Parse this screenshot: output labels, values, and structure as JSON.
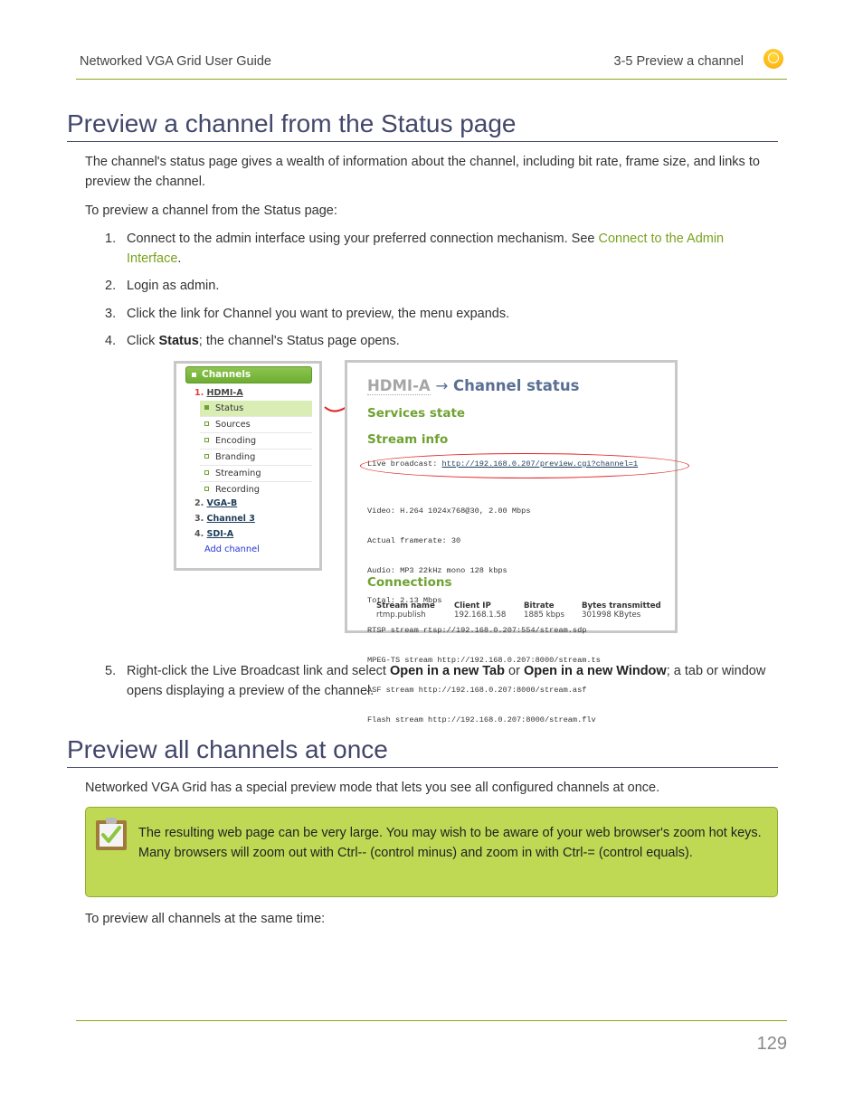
{
  "header": {
    "guide_title": "Networked VGA Grid User Guide",
    "section_title": "3-5 Preview a channel",
    "logo_icon": "epiphan-logo-icon"
  },
  "section1": {
    "heading": "Preview a channel from the Status page",
    "intro": "The channel's status page gives a wealth of information about the channel, including bit rate, frame size, and links to preview the channel.",
    "lead": "To preview a channel from the Status page:",
    "steps": [
      {
        "num": "1.",
        "before": "Connect to the admin interface using your preferred connection mechanism. See ",
        "link": "Connect to the Admin Interface",
        "after": "."
      },
      {
        "num": "2.",
        "text": "Login as admin."
      },
      {
        "num": "3.",
        "text": "Click the link for Channel you want to preview, the menu expands."
      },
      {
        "num": "4.",
        "before": "Click ",
        "bold": "Status",
        "after": "; the channel's Status page opens."
      },
      {
        "num": "5.",
        "before": "Right-click the Live Broadcast link and select ",
        "bold1": "Open in a new Tab",
        "mid": " or ",
        "bold2": "Open in a new Window",
        "after": "; a tab or window opens displaying a preview of the channel."
      }
    ]
  },
  "screenshot_sidebar": {
    "header": "Channels",
    "channels": [
      {
        "num": "1.",
        "name": "HDMI-A"
      },
      {
        "num": "2.",
        "name": "VGA-B"
      },
      {
        "num": "3.",
        "name": "Channel 3"
      },
      {
        "num": "4.",
        "name": "SDI-A"
      }
    ],
    "submenu": [
      "Status",
      "Sources",
      "Encoding",
      "Branding",
      "Streaming",
      "Recording"
    ],
    "active_submenu": "Status",
    "add_channel": "Add channel"
  },
  "screenshot_status": {
    "breadcrumb_channel": "HDMI-A",
    "breadcrumb_arrow": "→",
    "breadcrumb_page": "Channel status",
    "services_state": "Services state",
    "stream_info": "Stream info",
    "live_broadcast_label": "Live broadcast: ",
    "live_broadcast_url": "http://192.168.0.207/preview.cgi?channel=1",
    "info_lines": [
      "Video: H.264 1024x768@30, 2.00 Mbps",
      "Actual framerate: 30",
      "Audio: MP3 22kHz mono 128 kbps",
      "Total: 2.13 Mbps",
      "RTSP stream rtsp://192.168.0.207:554/stream.sdp",
      "MPEG-TS stream http://192.168.0.207:8000/stream.ts",
      "ASF stream http://192.168.0.207:8000/stream.asf",
      "Flash stream http://192.168.0.207:8000/stream.flv"
    ],
    "connections": "Connections",
    "table": {
      "headers": [
        "Stream name",
        "Client IP",
        "Bitrate",
        "Bytes transmitted"
      ],
      "rows": [
        [
          "rtmp.publish",
          "192.168.1.58",
          "1885 kbps",
          "301998 KBytes"
        ]
      ]
    }
  },
  "section2": {
    "heading": "Preview all channels at once",
    "intro": "Networked VGA Grid has a special preview mode that lets you see all configured channels at once.",
    "note": "The resulting web page can be very large. You may wish to be aware of your web browser's zoom hot keys. Many browsers will zoom out with Ctrl-- (control minus) and zoom in with Ctrl-= (control equals).",
    "lead": "To preview all channels at the same time:"
  },
  "footer": {
    "page_number": "129"
  },
  "colors": {
    "accent_green": "#8fa31c",
    "heading": "#43476a",
    "link": "#7aa21d",
    "note_bg": "#bfd955",
    "highlight_red": "#e32525"
  }
}
